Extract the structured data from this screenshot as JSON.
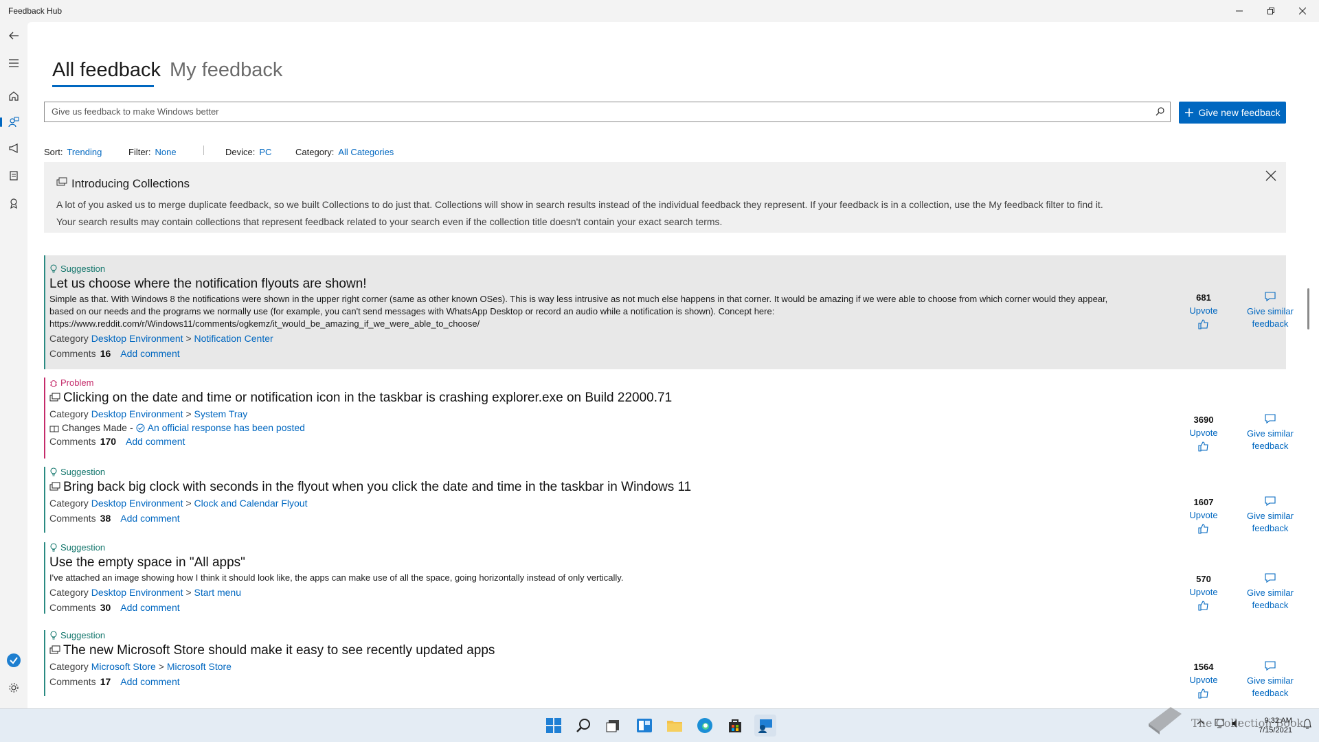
{
  "window": {
    "title": "Feedback Hub"
  },
  "tabs": {
    "all": "All feedback",
    "my": "My feedback"
  },
  "search": {
    "placeholder": "Give us feedback to make Windows better"
  },
  "new_feedback_label": "Give new feedback",
  "filters": {
    "sort_label": "Sort:",
    "sort_value": "Trending",
    "filter_label": "Filter:",
    "filter_value": "None",
    "device_label": "Device:",
    "device_value": "PC",
    "category_label": "Category:",
    "category_value": "All Categories"
  },
  "banner": {
    "title": "Introducing Collections",
    "line1": "A lot of you asked us to merge duplicate feedback, so we built Collections to do just that. Collections will show in search results instead of the individual feedback they represent. If your feedback is in a collection, use the My feedback filter to find it.",
    "line2": "Your search results may contain collections that represent feedback related to your search even if the collection title doesn't contain your exact search terms."
  },
  "labels": {
    "category": "Category",
    "comments": "Comments",
    "add_comment": "Add comment",
    "upvote": "Upvote",
    "give_similar": "Give similar feedback",
    "sep": ">"
  },
  "items": [
    {
      "type": "Suggestion",
      "title": "Let us choose where the notification flyouts are shown!",
      "description": "Simple as that. With Windows 8 the notifications were shown in the upper right corner (same as other known OSes). This is way less intrusive as not much else happens in that corner. It would be amazing if we were able to choose from which corner would they appear, based on our needs and the programs we normally use (for example, you can't send messages with WhatsApp Desktop or record an audio while a notification is shown). Concept here: https://www.reddit.com/r/Windows11/comments/ogkemz/it_would_be_amazing_if_we_were_able_to_choose/",
      "category": "Desktop Environment",
      "subcategory": "Notification Center",
      "comments": "16",
      "votes": "681"
    },
    {
      "type": "Problem",
      "title": "Clicking on the date and time or notification icon in the taskbar is crashing explorer.exe on Build 22000.71",
      "category": "Desktop Environment",
      "subcategory": "System Tray",
      "status": "Changes Made",
      "status_dash": "-",
      "official": "An official response has been posted",
      "comments": "170",
      "votes": "3690"
    },
    {
      "type": "Suggestion",
      "title": "Bring back big clock with seconds in the flyout when you click the date and time in the taskbar in Windows 11",
      "category": "Desktop Environment",
      "subcategory": "Clock and Calendar Flyout",
      "comments": "38",
      "votes": "1607"
    },
    {
      "type": "Suggestion",
      "title": "Use the empty space in \"All apps\"",
      "description": "I've attached an image showing how I think it should look like, the apps can make use of all the space, going horizontally instead of only vertically.",
      "category": "Desktop Environment",
      "subcategory": "Start menu",
      "comments": "30",
      "votes": "570"
    },
    {
      "type": "Suggestion",
      "title": "The new Microsoft Store should make it easy to see recently updated apps",
      "category": "Microsoft Store",
      "subcategory": "Microsoft Store",
      "comments": "17",
      "votes": "1564"
    }
  ],
  "taskbar": {
    "time": "9:32 AM",
    "date": "7/15/2021",
    "watermark": "The Collection Book"
  },
  "colors": {
    "accent": "#0067c0",
    "suggestion": "#13766c",
    "problem": "#c42b6a"
  }
}
